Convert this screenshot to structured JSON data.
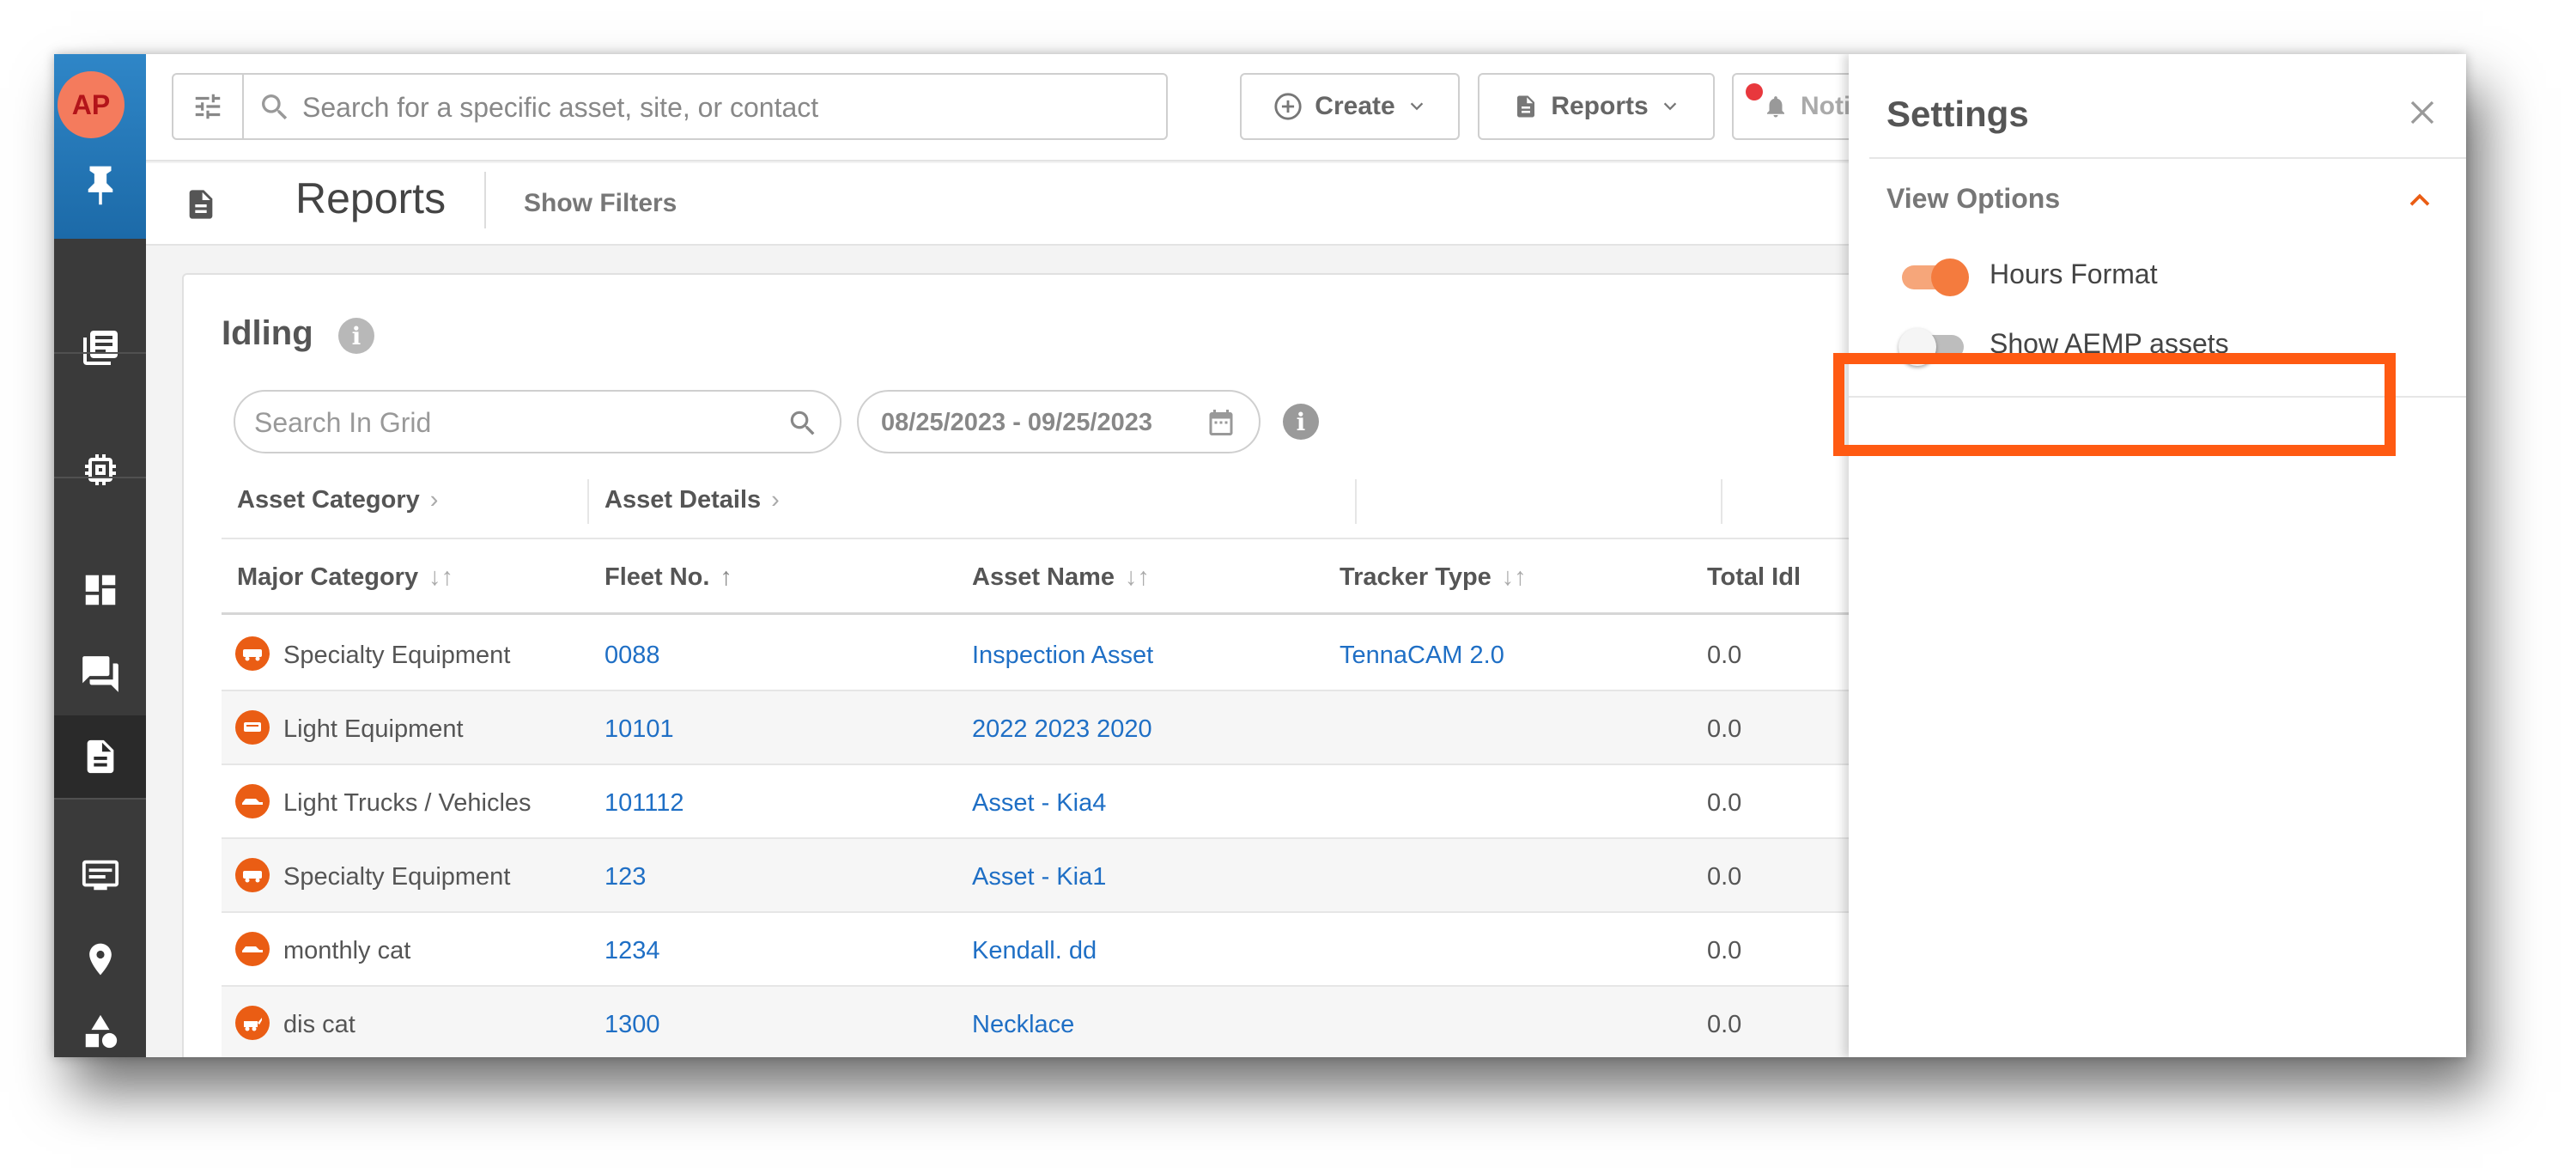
{
  "user": {
    "initials": "AP"
  },
  "topbar": {
    "search_placeholder": "Search for a specific asset, site, or contact",
    "create_label": "Create",
    "reports_label": "Reports",
    "notifications_label": "Noti"
  },
  "page": {
    "title": "Reports",
    "show_filters_label": "Show Filters"
  },
  "report": {
    "title": "Idling",
    "grid_search_placeholder": "Search In Grid",
    "date_range": "08/25/2023 - 09/25/2023",
    "groups": [
      "Asset Category",
      "Asset Details"
    ],
    "columns": [
      "Major Category",
      "Fleet No.",
      "Asset Name",
      "Tracker Type",
      "Total Idl"
    ],
    "rows": [
      {
        "category": "Specialty Equipment",
        "fleet": "0088",
        "asset": "Inspection Asset",
        "tracker": "TennaCAM 2.0",
        "total": "0.0"
      },
      {
        "category": "Light Equipment",
        "fleet": "10101",
        "asset": "2022 2023 2020",
        "tracker": "",
        "total": "0.0"
      },
      {
        "category": "Light Trucks / Vehicles",
        "fleet": "101112",
        "asset": "Asset - Kia4",
        "tracker": "",
        "total": "0.0"
      },
      {
        "category": "Specialty Equipment",
        "fleet": "123",
        "asset": "Asset - Kia1",
        "tracker": "",
        "total": "0.0"
      },
      {
        "category": "monthly cat",
        "fleet": "1234",
        "asset": "Kendall. dd",
        "tracker": "",
        "total": "0.0"
      },
      {
        "category": "dis cat",
        "fleet": "1300",
        "asset": "Necklace",
        "tracker": "",
        "total": "0.0"
      }
    ]
  },
  "settings": {
    "title": "Settings",
    "section_label": "View Options",
    "options": [
      {
        "label": "Hours Format",
        "enabled": true
      },
      {
        "label": "Show AEMP assets",
        "enabled": false
      }
    ]
  },
  "colors": {
    "accent": "#ff5a12",
    "toggle_on": "#f47b3e",
    "link": "#1f6fc5",
    "sidebar": "#3a3a3a"
  }
}
